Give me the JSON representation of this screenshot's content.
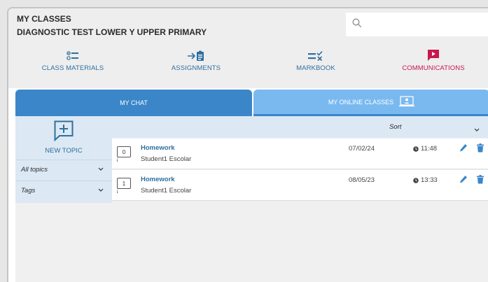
{
  "header": {
    "title": "MY CLASSES",
    "class_name": "DIAGNOSTIC TEST LOWER Y UPPER PRIMARY",
    "search_placeholder": ""
  },
  "nav": [
    {
      "label": "CLASS MATERIALS",
      "icon": "list-icon"
    },
    {
      "label": "ASSIGNMENTS",
      "icon": "assignment-arrow-icon"
    },
    {
      "label": "MARKBOOK",
      "icon": "markbook-icon"
    },
    {
      "label": "COMMUNICATIONS",
      "icon": "play-message-icon",
      "active": true
    }
  ],
  "tabs": {
    "chat": "MY CHAT",
    "online": "MY ONLINE CLASSES"
  },
  "sidebar": {
    "new_topic": "NEW TOPIC",
    "topics_filter": "All topics",
    "tags_filter": "Tags"
  },
  "sort_label": "Sort",
  "threads": [
    {
      "count": "0",
      "subject": "Homework",
      "author": "Student1 Escolar",
      "date": "07/02/24",
      "time": "11:48"
    },
    {
      "count": "1",
      "subject": "Homework",
      "author": "Student1 Escolar",
      "date": "08/05/23",
      "time": "13:33"
    }
  ],
  "colors": {
    "accent_blue": "#3a86c8",
    "light_blue": "#7ab9f0",
    "link_blue": "#2f6f9f",
    "communications_red": "#c8174d"
  }
}
